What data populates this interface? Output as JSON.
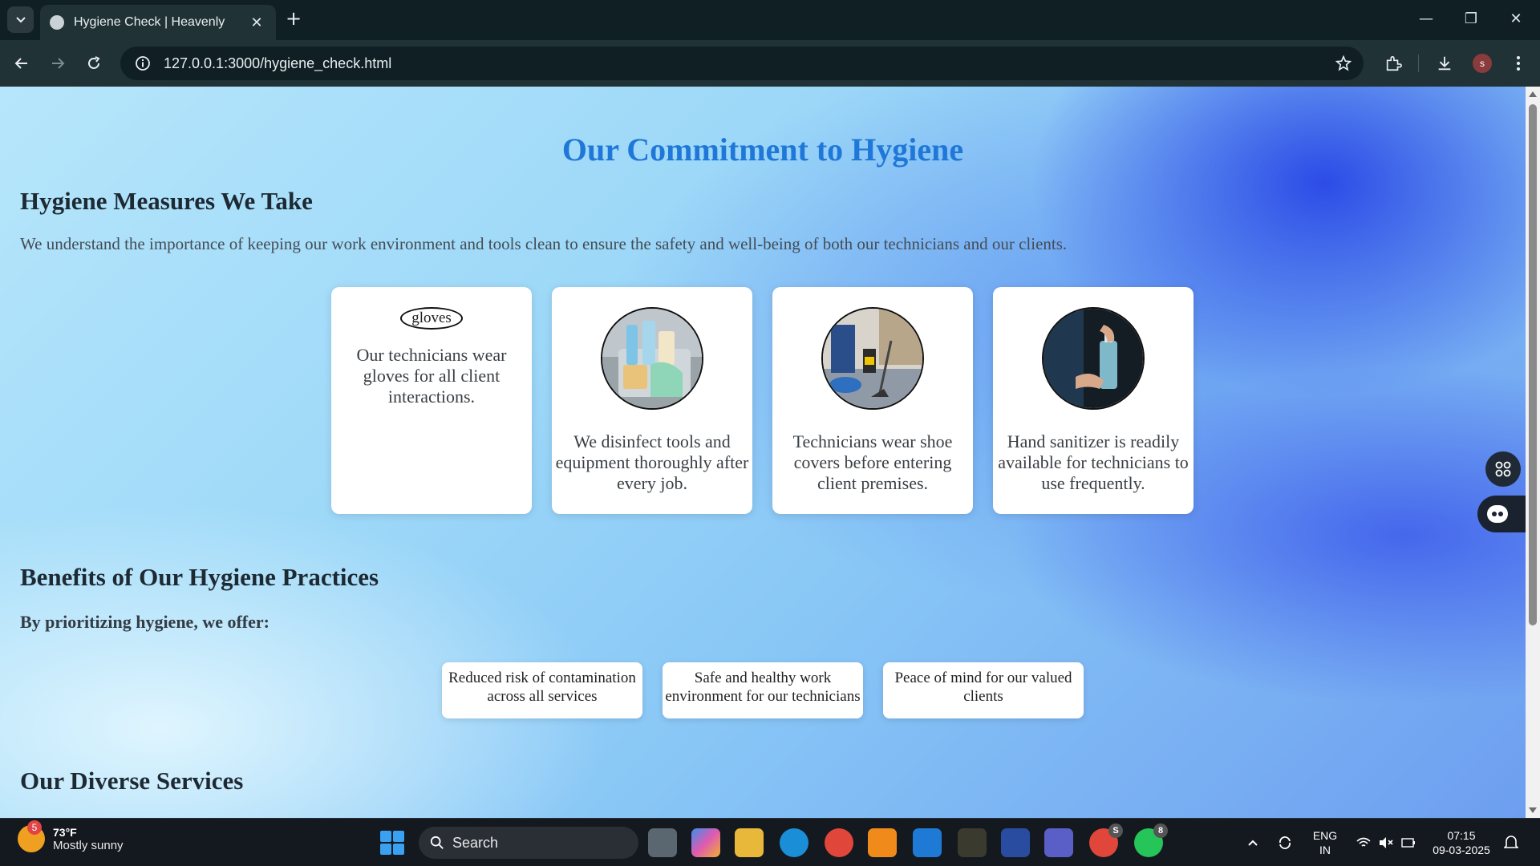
{
  "browser": {
    "tab_title": "Hygiene Check | Heavenly",
    "url": "127.0.0.1:3000/hygiene_check.html",
    "profile_initial": "s"
  },
  "page": {
    "title": "Our Commitment to Hygiene",
    "measures_heading": "Hygiene Measures We Take",
    "intro": "We understand the importance of keeping our work environment and tools clean to ensure the safety and well-being of both our technicians and our clients.",
    "cards": [
      {
        "alt": "gloves",
        "text": "Our technicians wear gloves for all client interactions."
      },
      {
        "text": "We disinfect tools and equipment thoroughly after every job."
      },
      {
        "text": "Technicians wear shoe covers before entering client premises."
      },
      {
        "text": "Hand sanitizer is readily available for technicians to use frequently."
      }
    ],
    "benefits_heading": "Benefits of Our Hygiene Practices",
    "benefits_sub": "By prioritizing hygiene, we offer:",
    "benefits": [
      "Reduced risk of contamination across all services",
      "Safe and healthy work environment for our technicians",
      "Peace of mind for our valued clients"
    ],
    "services_heading": "Our Diverse Services"
  },
  "taskbar": {
    "weather_temp": "73°F",
    "weather_desc": "Mostly sunny",
    "weather_badge": "5",
    "search_label": "Search",
    "chrome_badge": "S",
    "whatsapp_badge": "8",
    "lang": "ENG",
    "region": "IN",
    "time": "07:15",
    "date": "09-03-2025"
  },
  "colors": {
    "title": "#1f78d8",
    "browser_bg": "#213236"
  }
}
